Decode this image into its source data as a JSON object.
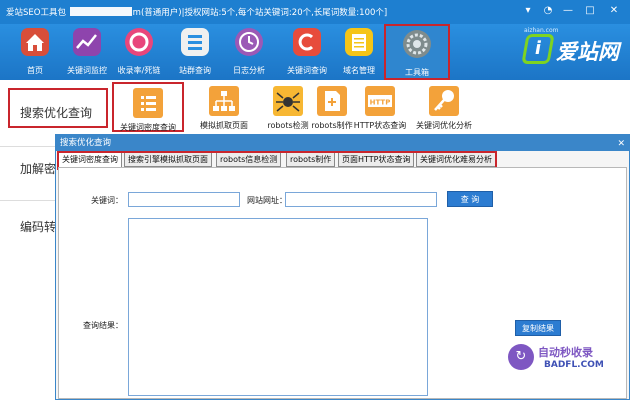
{
  "window": {
    "title_prefix": "爱站SEO工具包",
    "title_suffix": "m(普通用户)|授权网站:5个,每个站关键词:20个,长尾词数量:100个]",
    "minimize": "—",
    "maximize": "□",
    "close": "✕"
  },
  "toolbar": {
    "items": [
      {
        "label": "首页"
      },
      {
        "label": "关键词监控"
      },
      {
        "label": "收录率/死链"
      },
      {
        "label": "站群查询"
      },
      {
        "label": "日志分析"
      },
      {
        "label": "关键词查询"
      },
      {
        "label": "域名管理"
      },
      {
        "label": "工具箱"
      }
    ],
    "active_index": 7
  },
  "logo": {
    "mark": "i",
    "text": "爱站网",
    "sub": "aizhan.com"
  },
  "leftnav": {
    "items": [
      {
        "label": "搜索优化查询"
      },
      {
        "label": "加解密"
      },
      {
        "label": "编码转"
      }
    ]
  },
  "subtools": {
    "items": [
      {
        "label": "关键词密度查询"
      },
      {
        "label": "模拟抓取页面"
      },
      {
        "label": "robots检测"
      },
      {
        "label": "robots制作"
      },
      {
        "label": "HTTP状态查询"
      },
      {
        "label": "关键词优化分析"
      }
    ],
    "active_index": 0
  },
  "dialog": {
    "title": "搜索优化查询",
    "close": "✕",
    "tabs": [
      {
        "label": "关键词密度查询"
      },
      {
        "label": "搜索引擎模拟抓取页面"
      },
      {
        "label": "robots信息检测"
      },
      {
        "label": "robots制作"
      },
      {
        "label": "页面HTTP状态查询"
      },
      {
        "label": "关键词优化难易分析"
      }
    ],
    "active_tab": 0,
    "keyword_label": "关键词：",
    "keyword_value": "",
    "site_label": "网站网址：",
    "site_value": "",
    "query_button": "查 询",
    "result_label": "查询结果：",
    "copy_button": "复制结果"
  },
  "watermark": {
    "badge": "↻",
    "line1": "自动秒收录",
    "line2": "BADFL.COM"
  },
  "colors": {
    "titlebar": "#1e7fd0",
    "toolbar": "#2a8fe0",
    "highlight": "#c9252c",
    "button": "#2c7cd1"
  }
}
